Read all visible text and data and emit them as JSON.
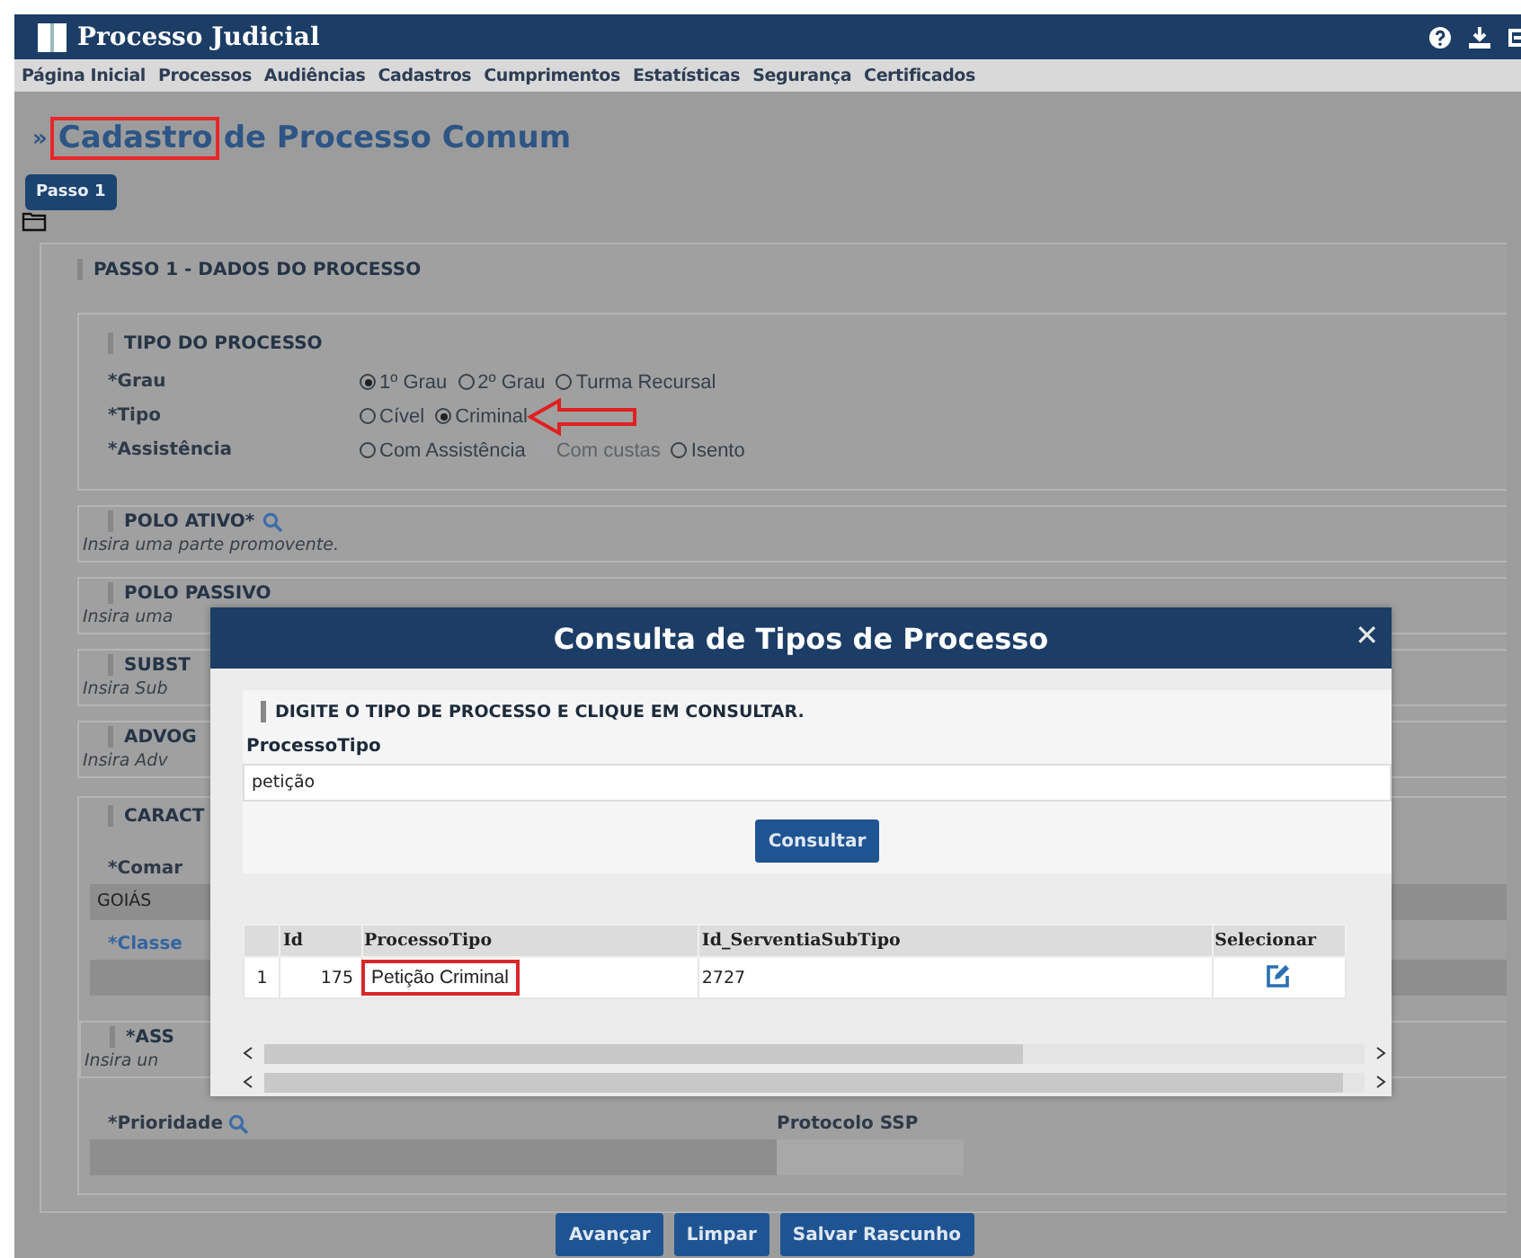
{
  "header": {
    "title": "Processo Judicial"
  },
  "menu": [
    "Página Inicial",
    "Processos",
    "Audiências",
    "Cadastros",
    "Cumprimentos",
    "Estatísticas",
    "Segurança",
    "Certificados"
  ],
  "breadcrumb_mark": "»",
  "page_title_highlight": "Cadastro",
  "page_title_rest": "de Processo Comum",
  "step_tab": {
    "label": "Passo 1",
    "selected": true
  },
  "section_title": "PASSO 1 - DADOS DO PROCESSO",
  "tipo_group": {
    "title": "TIPO DO PROCESSO",
    "fields": [
      {
        "label": "*Grau",
        "options": [
          {
            "label": "1º Grau",
            "selected": true,
            "disabled": false
          },
          {
            "label": "2º Grau",
            "selected": false,
            "disabled": false
          },
          {
            "label": "Turma Recursal",
            "selected": false,
            "disabled": false
          }
        ]
      },
      {
        "label": "*Tipo",
        "options": [
          {
            "label": "Cível",
            "selected": false,
            "disabled": false
          },
          {
            "label": "Criminal",
            "selected": true,
            "disabled": false
          }
        ]
      },
      {
        "label": "*Assistência",
        "options": [
          {
            "label": "Com Assistência",
            "selected": false,
            "disabled": false
          },
          {
            "label": "Com custas",
            "selected": false,
            "disabled": true
          },
          {
            "label": "Isento",
            "selected": false,
            "disabled": false
          }
        ]
      }
    ]
  },
  "panels": [
    {
      "title": "POLO ATIVO*",
      "hint": "Insira uma parte promovente.",
      "search": true
    },
    {
      "title": "POLO PASSIVO",
      "hint": "Insira uma",
      "search": false
    },
    {
      "title": "SUBST",
      "hint": "Insira Sub",
      "search": false
    },
    {
      "title": "ADVOG",
      "hint": "Insira Adv",
      "search": false
    }
  ],
  "caracteristicas": {
    "title": "CARACT",
    "comarca_label": "*Comar",
    "comarca_value": "GOIÁS",
    "classe_label": "*Classe",
    "assuntos_title": "*ASS",
    "assuntos_hint": "Insira un",
    "prioridade_label": "*Prioridade",
    "protocolo_label": "Protocolo SSP"
  },
  "buttons": [
    "Avançar",
    "Limpar",
    "Salvar Rascunho"
  ],
  "modal": {
    "title": "Consulta de Tipos de Processo",
    "close": "✕",
    "instruction": "DIGITE O TIPO DE PROCESSO E CLIQUE EM CONSULTAR.",
    "field_label": "ProcessoTipo",
    "field_value": "petição",
    "button": "Consultar",
    "table": {
      "columns": [
        "Id",
        "ProcessoTipo",
        "Id_ServentiaSubTipo",
        "Selecionar"
      ],
      "rows": [
        {
          "number": "1",
          "id": "175",
          "processo_tipo": "Petição Criminal",
          "subtipo": "2727"
        }
      ]
    }
  }
}
